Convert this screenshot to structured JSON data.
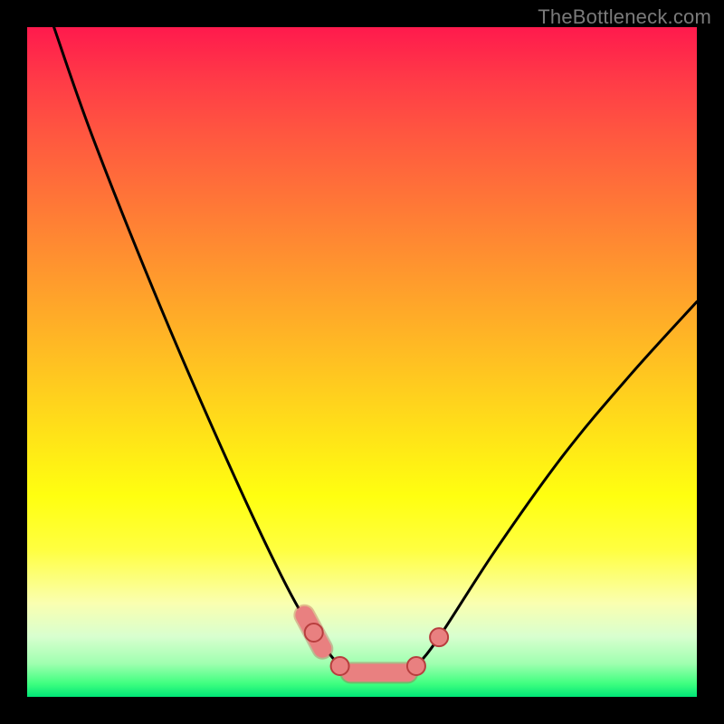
{
  "watermark": {
    "text": "TheBottleneck.com"
  },
  "colors": {
    "frame": "#000000",
    "curve_stroke": "#000000",
    "marker_stroke": "#b83e3e",
    "marker_fill": "#e98080",
    "capsule_fill": "#e98080",
    "capsule_stroke": "#b83e3e"
  },
  "chart_data": {
    "type": "line",
    "title": "",
    "xlabel": "",
    "ylabel": "",
    "xlim": [
      0,
      100
    ],
    "ylim": [
      0,
      100
    ],
    "grid": false,
    "legend": false,
    "series": [
      {
        "name": "left-branch",
        "x": [
          4,
          10,
          20,
          30,
          38,
          42.8,
          46.7,
          48.3
        ],
        "y": [
          100,
          83,
          58,
          35,
          18,
          9.6,
          4.6,
          3.6
        ]
      },
      {
        "name": "right-branch",
        "x": [
          56.8,
          58.1,
          61.5,
          70,
          80,
          90,
          100
        ],
        "y": [
          3.6,
          4.6,
          8.9,
          22,
          36,
          48,
          59
        ]
      },
      {
        "name": "base-plateau",
        "x": [
          48.3,
          56.8
        ],
        "y": [
          3.6,
          3.6
        ]
      }
    ],
    "markers": [
      {
        "x": 42.8,
        "y": 9.6
      },
      {
        "x": 46.7,
        "y": 4.6
      },
      {
        "x": 58.1,
        "y": 4.6
      },
      {
        "x": 61.5,
        "y": 8.9
      }
    ],
    "capsules": [
      {
        "x1": 41.4,
        "y1": 12.2,
        "x2": 44.1,
        "y2": 7.2
      },
      {
        "x1": 48.3,
        "y1": 3.6,
        "x2": 56.8,
        "y2": 3.6
      }
    ]
  }
}
